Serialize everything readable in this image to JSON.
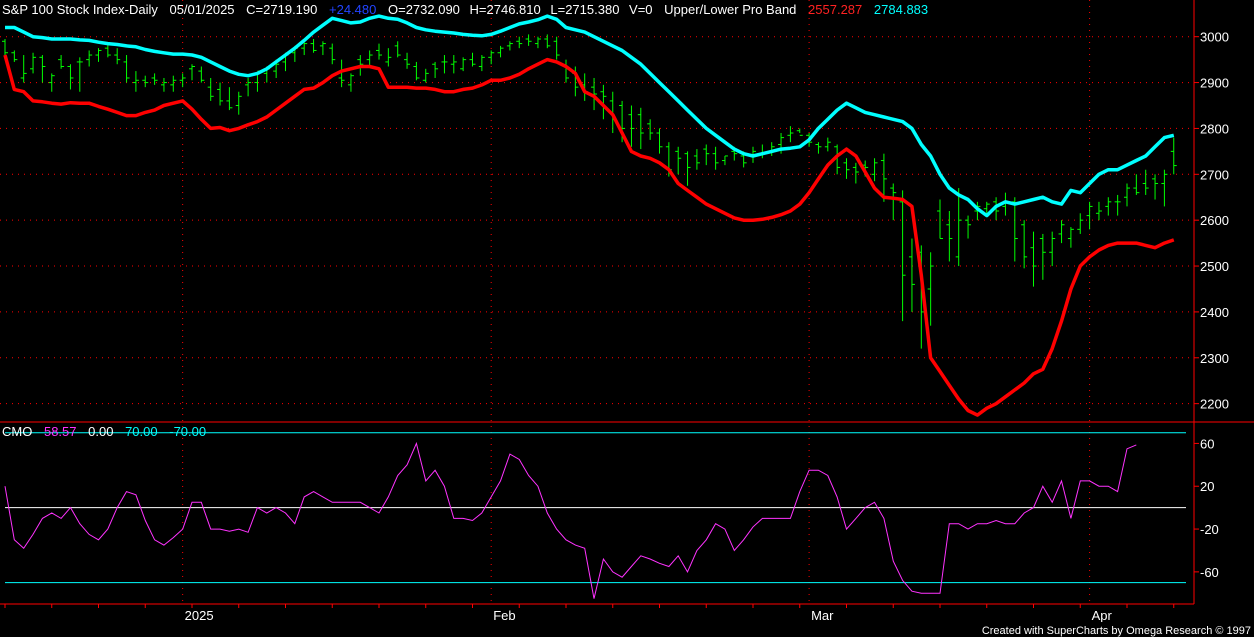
{
  "header": {
    "symbol": "S&P 100 Stock Index-Daily",
    "date": "05/01/2025",
    "close": "C=2719.190",
    "change": "+24.480",
    "open": "O=2732.090",
    "high": "H=2746.810",
    "low": "L=2715.380",
    "volume": "V=0",
    "study": "Upper/Lower Pro Band",
    "lower_value": "2557.287",
    "upper_value": "2784.883"
  },
  "sub_header": {
    "name": "CMO",
    "value": "58.57",
    "zero": "0.00",
    "upper": "70.00",
    "lower": "-70.00"
  },
  "footer": {
    "credit": "Created with SuperCharts by Omega Research © 1997"
  },
  "colors": {
    "background": "#000000",
    "price_bars": "#00ff00",
    "upper_band": "#00ffff",
    "lower_band": "#ff0000",
    "cmo_line": "#ff33ff",
    "cmo_levels": "#00ffff",
    "zero_line": "#ffffff",
    "grid": "#ff0000",
    "text": "#ffffff",
    "change_text": "#0000ff"
  },
  "chart_data": [
    {
      "type": "bar",
      "ohlc": true,
      "title": "S&P 100 Stock Index-Daily",
      "y_ticks": [
        3000,
        2900,
        2800,
        2700,
        2600,
        2500,
        2400,
        2300,
        2200
      ],
      "ylim": [
        2160,
        3080
      ],
      "x_month_labels": [
        "2025",
        "Feb",
        "Mar",
        "Apr"
      ],
      "x_month_indices": [
        19,
        52,
        86,
        116
      ],
      "grid": "dotted",
      "high": [
        2995,
        2970,
        2960,
        2965,
        2960,
        2920,
        2960,
        2940,
        2955,
        2970,
        2975,
        2985,
        2975,
        2960,
        2925,
        2915,
        2920,
        2910,
        2915,
        2920,
        2940,
        2935,
        2910,
        2900,
        2890,
        2880,
        2910,
        2920,
        2935,
        2950,
        2965,
        2980,
        2990,
        2995,
        2990,
        2985,
        2950,
        2920,
        2960,
        2970,
        2985,
        2975,
        2990,
        2965,
        2945,
        2930,
        2945,
        2960,
        2960,
        2955,
        2965,
        2960,
        2970,
        2980,
        2990,
        3000,
        3005,
        3000,
        3005,
        3000,
        2950,
        2935,
        2920,
        2910,
        2895,
        2880,
        2860,
        2850,
        2845,
        2820,
        2800,
        2770,
        2760,
        2750,
        2755,
        2765,
        2760,
        2740,
        2760,
        2750,
        2760,
        2765,
        2770,
        2790,
        2805,
        2800,
        2790,
        2770,
        2780,
        2765,
        2735,
        2725,
        2730,
        2735,
        2745,
        2680,
        2665,
        2560,
        2545,
        2530,
        2645,
        2620,
        2670,
        2610,
        2640,
        2640,
        2650,
        2660,
        2650,
        2600,
        2575,
        2570,
        2575,
        2600,
        2585,
        2615,
        2640,
        2640,
        2650,
        2655,
        2680,
        2700,
        2710,
        2700,
        2710,
        2780
      ],
      "low": [
        2960,
        2945,
        2900,
        2920,
        2900,
        2880,
        2930,
        2885,
        2880,
        2935,
        2945,
        2955,
        2940,
        2900,
        2880,
        2890,
        2895,
        2880,
        2880,
        2890,
        2905,
        2900,
        2860,
        2850,
        2840,
        2830,
        2870,
        2880,
        2900,
        2910,
        2925,
        2945,
        2960,
        2965,
        2960,
        2940,
        2890,
        2880,
        2915,
        2935,
        2950,
        2935,
        2955,
        2930,
        2905,
        2900,
        2910,
        2920,
        2920,
        2925,
        2935,
        2925,
        2940,
        2955,
        2970,
        2975,
        2980,
        2975,
        2975,
        2950,
        2900,
        2870,
        2860,
        2840,
        2820,
        2790,
        2770,
        2760,
        2755,
        2775,
        2745,
        2695,
        2700,
        2675,
        2710,
        2720,
        2710,
        2720,
        2730,
        2715,
        2725,
        2735,
        2740,
        2745,
        2770,
        2790,
        2760,
        2745,
        2750,
        2700,
        2690,
        2680,
        2695,
        2685,
        2640,
        2600,
        2380,
        2400,
        2320,
        2370,
        2560,
        2510,
        2500,
        2560,
        2600,
        2610,
        2600,
        2610,
        2510,
        2495,
        2455,
        2470,
        2500,
        2550,
        2540,
        2570,
        2580,
        2600,
        2610,
        2610,
        2630,
        2655,
        2655,
        2645,
        2630,
        2700
      ],
      "open": [
        2990,
        2965,
        2910,
        2930,
        2955,
        2900,
        2950,
        2935,
        2945,
        2950,
        2960,
        2975,
        2960,
        2945,
        2900,
        2905,
        2910,
        2895,
        2895,
        2905,
        2930,
        2925,
        2890,
        2885,
        2860,
        2850,
        2895,
        2900,
        2920,
        2925,
        2945,
        2965,
        2975,
        2985,
        2980,
        2975,
        2910,
        2895,
        2950,
        2950,
        2970,
        2945,
        2980,
        2950,
        2935,
        2905,
        2940,
        2945,
        2940,
        2930,
        2950,
        2935,
        2955,
        2965,
        2980,
        2990,
        2995,
        2985,
        2995,
        2990,
        2935,
        2920,
        2895,
        2890,
        2880,
        2860,
        2850,
        2830,
        2830,
        2810,
        2790,
        2760,
        2750,
        2745,
        2740,
        2755,
        2745,
        2730,
        2750,
        2740,
        2740,
        2745,
        2750,
        2765,
        2785,
        2795,
        2785,
        2765,
        2760,
        2760,
        2725,
        2715,
        2720,
        2700,
        2730,
        2670,
        2640,
        2520,
        2530,
        2450,
        2620,
        2590,
        2520,
        2600,
        2620,
        2625,
        2640,
        2630,
        2640,
        2590,
        2540,
        2560,
        2530,
        2570,
        2560,
        2580,
        2610,
        2615,
        2630,
        2640,
        2650,
        2670,
        2680,
        2690,
        2680,
        2750
      ],
      "close": [
        2965,
        2950,
        2920,
        2955,
        2935,
        2915,
        2935,
        2910,
        2945,
        2960,
        2970,
        2960,
        2950,
        2910,
        2905,
        2900,
        2905,
        2900,
        2905,
        2910,
        2935,
        2905,
        2870,
        2860,
        2845,
        2870,
        2900,
        2925,
        2930,
        2940,
        2960,
        2975,
        2985,
        2970,
        2985,
        2950,
        2905,
        2915,
        2940,
        2960,
        2960,
        2955,
        2960,
        2940,
        2910,
        2920,
        2930,
        2945,
        2945,
        2950,
        2940,
        2955,
        2965,
        2975,
        2985,
        2985,
        2990,
        2995,
        2980,
        2960,
        2910,
        2890,
        2880,
        2875,
        2870,
        2820,
        2800,
        2800,
        2790,
        2790,
        2760,
        2710,
        2735,
        2715,
        2725,
        2745,
        2725,
        2740,
        2745,
        2725,
        2750,
        2745,
        2760,
        2780,
        2790,
        2785,
        2770,
        2760,
        2770,
        2715,
        2710,
        2705,
        2715,
        2725,
        2690,
        2660,
        2480,
        2460,
        2400,
        2500,
        2560,
        2560,
        2600,
        2590,
        2630,
        2635,
        2620,
        2640,
        2560,
        2520,
        2500,
        2530,
        2560,
        2590,
        2580,
        2600,
        2630,
        2620,
        2640,
        2640,
        2670,
        2660,
        2670,
        2680,
        2700,
        2719
      ]
    },
    {
      "type": "line",
      "series": [
        {
          "name": "Upper",
          "values": [
            3020,
            3020,
            3010,
            3000,
            2998,
            2995,
            2995,
            2995,
            2993,
            2992,
            2988,
            2985,
            2983,
            2980,
            2978,
            2972,
            2968,
            2965,
            2962,
            2962,
            2960,
            2955,
            2945,
            2935,
            2925,
            2918,
            2915,
            2920,
            2930,
            2945,
            2960,
            2975,
            2992,
            3010,
            3025,
            3040,
            3035,
            3030,
            3032,
            3040,
            3045,
            3040,
            3038,
            3030,
            3020,
            3015,
            3012,
            3010,
            3008,
            3005,
            3003,
            3002,
            3005,
            3012,
            3020,
            3028,
            3032,
            3037,
            3045,
            3038,
            3020,
            3015,
            3010,
            3000,
            2990,
            2980,
            2970,
            2955,
            2940,
            2920,
            2900,
            2880,
            2860,
            2840,
            2820,
            2800,
            2785,
            2770,
            2755,
            2745,
            2740,
            2745,
            2750,
            2755,
            2757,
            2760,
            2775,
            2800,
            2820,
            2840,
            2855,
            2845,
            2835,
            2830,
            2825,
            2820,
            2815,
            2800,
            2765,
            2740,
            2700,
            2670,
            2655,
            2645,
            2625,
            2610,
            2630,
            2640,
            2635,
            2640,
            2645,
            2650,
            2640,
            2635,
            2665,
            2660,
            2680,
            2700,
            2710,
            2710,
            2720,
            2730,
            2740,
            2760,
            2780,
            2785
          ]
        },
        {
          "name": "Lower",
          "values": [
            2960,
            2885,
            2880,
            2860,
            2858,
            2855,
            2853,
            2856,
            2855,
            2855,
            2848,
            2842,
            2835,
            2828,
            2828,
            2835,
            2840,
            2850,
            2855,
            2860,
            2842,
            2820,
            2800,
            2802,
            2795,
            2800,
            2808,
            2815,
            2825,
            2840,
            2855,
            2870,
            2885,
            2888,
            2900,
            2915,
            2925,
            2930,
            2935,
            2935,
            2930,
            2890,
            2890,
            2890,
            2888,
            2888,
            2885,
            2880,
            2880,
            2885,
            2888,
            2895,
            2905,
            2905,
            2910,
            2918,
            2930,
            2940,
            2950,
            2945,
            2935,
            2920,
            2880,
            2870,
            2850,
            2830,
            2790,
            2750,
            2740,
            2735,
            2725,
            2710,
            2680,
            2665,
            2650,
            2635,
            2625,
            2615,
            2605,
            2600,
            2600,
            2602,
            2606,
            2612,
            2620,
            2635,
            2660,
            2690,
            2720,
            2740,
            2755,
            2740,
            2705,
            2670,
            2650,
            2648,
            2645,
            2630,
            2480,
            2300,
            2270,
            2240,
            2210,
            2185,
            2175,
            2190,
            2200,
            2215,
            2230,
            2245,
            2265,
            2275,
            2320,
            2380,
            2450,
            2500,
            2520,
            2535,
            2545,
            2550,
            2550,
            2550,
            2545,
            2540,
            2550,
            2557
          ]
        }
      ]
    },
    {
      "type": "line",
      "title": "CMO",
      "y_ticks": [
        60,
        20,
        -20,
        -60
      ],
      "ylim": [
        -90,
        80
      ],
      "reference_levels": [
        70,
        0,
        -70
      ],
      "series": [
        {
          "name": "CMO",
          "values": [
            20,
            -30,
            -38,
            -25,
            -10,
            -5,
            -10,
            0,
            -15,
            -25,
            -30,
            -20,
            0,
            15,
            12,
            -12,
            -30,
            -35,
            -28,
            -20,
            5,
            5,
            -20,
            -20,
            -22,
            -20,
            -23,
            0,
            -5,
            0,
            -5,
            -15,
            10,
            15,
            10,
            5,
            5,
            5,
            5,
            0,
            -5,
            10,
            30,
            40,
            60,
            25,
            35,
            20,
            -10,
            -10,
            -12,
            -5,
            10,
            25,
            50,
            45,
            30,
            20,
            -5,
            -20,
            -30,
            -35,
            -38,
            -85,
            -48,
            -60,
            -65,
            -55,
            -45,
            -48,
            -52,
            -55,
            -45,
            -60,
            -40,
            -30,
            -15,
            -20,
            -40,
            -30,
            -18,
            -10,
            -10,
            -10,
            -10,
            15,
            35,
            35,
            30,
            10,
            -20,
            -10,
            0,
            5,
            -10,
            -50,
            -68,
            -78,
            -80,
            -80,
            -80,
            -15,
            -15,
            -20,
            -15,
            -15,
            -12,
            -15,
            -15,
            -5,
            0,
            20,
            5,
            25,
            -10,
            25,
            25,
            20,
            20,
            15,
            55,
            58.57
          ]
        }
      ]
    }
  ]
}
